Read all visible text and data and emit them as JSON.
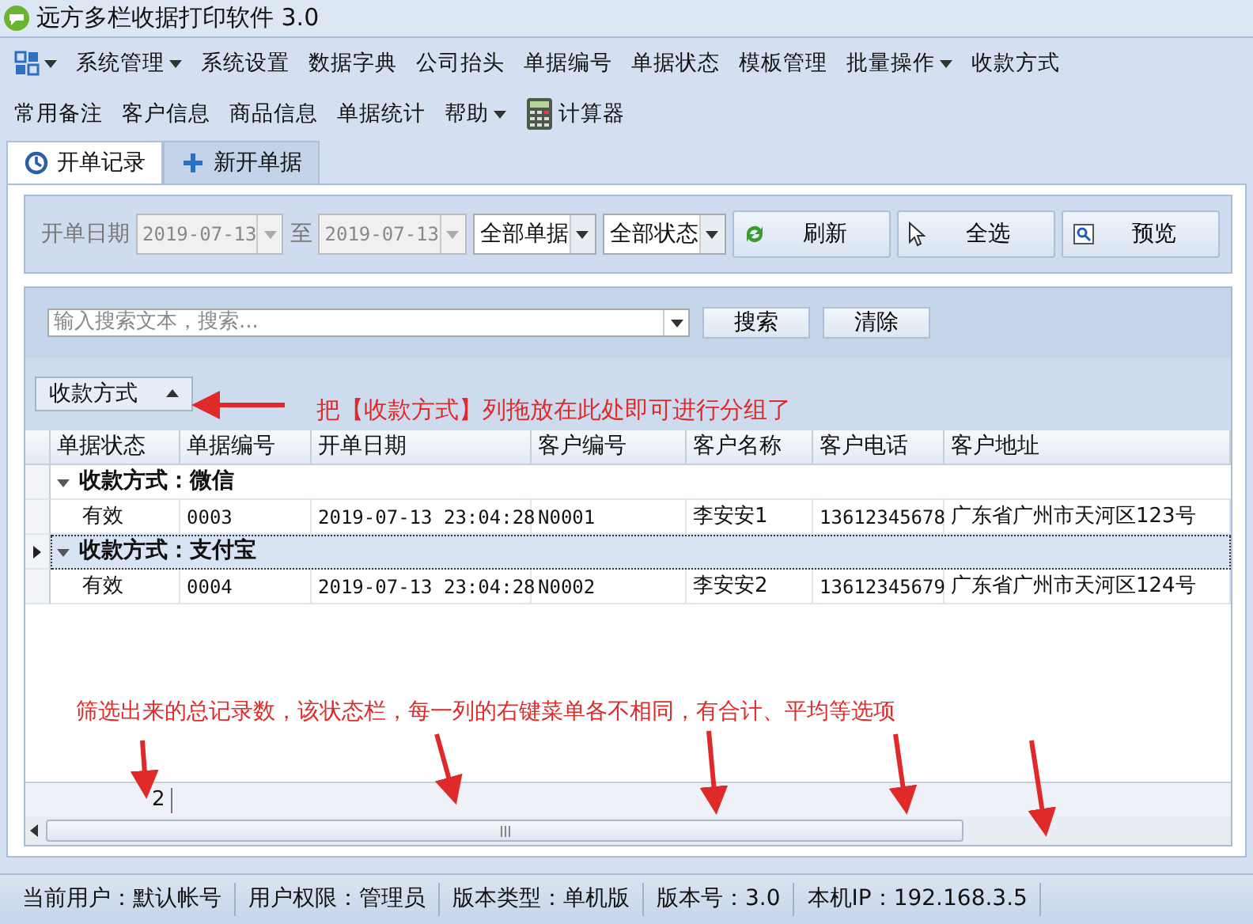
{
  "window": {
    "title": "远方多栏收据打印软件 3.0"
  },
  "menu_rows": [
    [
      {
        "kind": "apps",
        "dropdown": true
      },
      {
        "kind": "text",
        "label": "系统管理",
        "dropdown": true
      },
      {
        "kind": "text",
        "label": "系统设置",
        "dropdown": false
      },
      {
        "kind": "text",
        "label": "数据字典",
        "dropdown": false
      },
      {
        "kind": "text",
        "label": "公司抬头",
        "dropdown": false
      },
      {
        "kind": "text",
        "label": "单据编号",
        "dropdown": false
      },
      {
        "kind": "text",
        "label": "单据状态",
        "dropdown": false
      },
      {
        "kind": "text",
        "label": "模板管理",
        "dropdown": false
      },
      {
        "kind": "text",
        "label": "批量操作",
        "dropdown": true
      },
      {
        "kind": "text",
        "label": "收款方式",
        "dropdown": false
      }
    ],
    [
      {
        "kind": "text",
        "label": "常用备注",
        "dropdown": false
      },
      {
        "kind": "text",
        "label": "客户信息",
        "dropdown": false
      },
      {
        "kind": "text",
        "label": "商品信息",
        "dropdown": false
      },
      {
        "kind": "text",
        "label": "单据统计",
        "dropdown": false
      },
      {
        "kind": "text",
        "label": "帮助",
        "dropdown": true
      },
      {
        "kind": "calculator",
        "label": "计算器",
        "dropdown": false
      }
    ]
  ],
  "tabs": [
    {
      "label": "开单记录",
      "selected": true
    },
    {
      "label": "新开单据",
      "selected": false
    }
  ],
  "filter": {
    "date_label": "开单日期",
    "date_from": "2019-07-13",
    "to_label": "至",
    "date_to": "2019-07-13",
    "dates_disabled": true,
    "selects": [
      "全部单据",
      "全部状态"
    ],
    "buttons": [
      "刷新",
      "全选",
      "预览"
    ]
  },
  "search": {
    "placeholder": "输入搜索文本，搜索...",
    "buttons": [
      "搜索",
      "清除"
    ]
  },
  "group_panel": {
    "chips": [
      {
        "label": "收款方式",
        "sorted_ascending": true
      }
    ]
  },
  "grid": {
    "columns": [
      "单据状态",
      "单据编号",
      "开单日期",
      "客户编号",
      "客户名称",
      "客户电话",
      "客户地址"
    ],
    "groups": [
      {
        "label": "收款方式：微信",
        "expanded": true,
        "focused": false,
        "rows": [
          [
            "有效",
            "0003",
            "2019-07-13 23:04:28",
            "N0001",
            "李安安1",
            "13612345678",
            "广东省广州市天河区123号"
          ]
        ]
      },
      {
        "label": "收款方式：支付宝",
        "expanded": true,
        "focused": true,
        "rows": [
          [
            "有效",
            "0004",
            "2019-07-13 23:04:28",
            "N0002",
            "李安安2",
            "13612345679",
            "广东省广州市天河区124号"
          ]
        ]
      }
    ],
    "footer_count": "2"
  },
  "annotations": [
    {
      "text": "把【收款方式】列拖放在此处即可进行分组了"
    },
    {
      "text": "筛选出来的总记录数，该状态栏，每一列的右键菜单各不相同，有合计、平均等选项"
    }
  ],
  "status_bar": [
    "当前用户：默认帐号",
    "用户权限：管理员",
    "版本类型：单机版",
    "版本号：3.0",
    "本机IP：192.168.3.5"
  ]
}
